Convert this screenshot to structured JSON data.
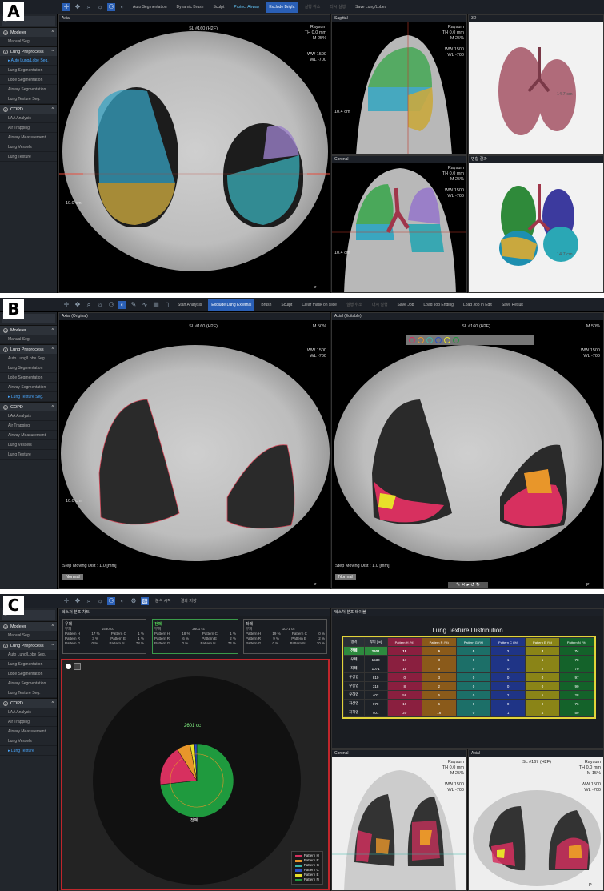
{
  "panel_labels": [
    "A",
    "B",
    "C"
  ],
  "sidebar": {
    "search_placeholder": "Q",
    "groups": [
      {
        "label": "Modeler",
        "items": [
          "Manual Seg."
        ]
      },
      {
        "label": "Lung Preprocess",
        "items": [
          "Auto Lung/Lobe Seg.",
          "Lung Segmentation",
          "Lobe Segmentation",
          "Airway Segmentation",
          "Lung Texture Seg."
        ]
      },
      {
        "label": "COPD",
        "items": [
          "LAA Analysis",
          "Air Trapping",
          "Airway Measurement",
          "Lung Vessels",
          "Lung Texture"
        ]
      }
    ]
  },
  "panelA": {
    "toolbar": {
      "auto_seg": "Auto Segmentation",
      "dynamic_brush": "Dynamic Brush",
      "sculpt": "Sculpt",
      "protect_airway": "Protect Airway",
      "exclude_bright": "Exclude Bright",
      "undo": "실행 취소",
      "redo": "다시 실행",
      "save": "Save Lung/Lobes"
    },
    "axial": {
      "title": "Axial",
      "slice": "SL #160 (H2F)",
      "raysum": "Raysum",
      "th": "TH 0.0 mm",
      "zoom": "M 25%",
      "ww": "WW  1500",
      "wl": "WL   -700",
      "scale": "10.0 cm",
      "orient": "P"
    },
    "sagittal": {
      "title": "Sagittal",
      "raysum": "Raysum",
      "th": "TH 0.0 mm",
      "zoom": "M 25%",
      "ww": "WW  1500",
      "wl": "WL   -700",
      "scale": "10.4 cm"
    },
    "coronal": {
      "title": "Coronal",
      "raysum": "Raysum",
      "th": "TH 0.0 mm",
      "zoom": "M 25%",
      "ww": "WW  1500",
      "wl": "WL   -700",
      "scale": "10.4 cm"
    },
    "view3d": {
      "title": "3D",
      "scale": "14.7 cm"
    },
    "viewMerged": {
      "title": "병합 결과",
      "scale": "14.7 cm"
    }
  },
  "panelB": {
    "toolbar": {
      "start_analysis": "Start Analysis",
      "exclude_lung_external": "Exclude Lung External",
      "brush": "Brush",
      "sculpt": "Sculpt",
      "clear_mask": "Clear mask on slice",
      "undo": "실행 취소",
      "redo": "다시 실행",
      "save_job": "Save Job",
      "load_job_ending": "Load Job Ending",
      "load_job_edit": "Load Job in Edit",
      "save_result": "Save Result"
    },
    "left": {
      "title": "Axial (Original)",
      "slice": "SL #160 (H2F)",
      "zoom": "M 50%",
      "ww": "WW  1500",
      "wl": "WL   -700",
      "scale": "10.0 cm",
      "step": "Step Moving Dist : 1.0 [mm]",
      "normal": "Normal",
      "orient": "P"
    },
    "right": {
      "title": "Axial (Editable)",
      "slice": "SL #160 (H2F)",
      "zoom": "M 50%",
      "ww": "WW  1500",
      "wl": "WL   -700",
      "step": "Step Moving Dist : 1.0 [mm]",
      "normal": "Normal",
      "orient": "P"
    }
  },
  "panelC": {
    "toolbar": {
      "analysis_start": "분석 시작",
      "save_result": "결과 저장"
    },
    "chart_panel_title": "텍스처 분포 차트",
    "table_panel_title": "텍스처 분포 테이블",
    "stat_boxes": [
      {
        "name": "우폐",
        "vol_label": "부피",
        "vol": "1530 cc",
        "rows": [
          [
            "Pattern H",
            "17 %",
            "Pattern C",
            "1 %"
          ],
          [
            "Pattern R",
            "3 %",
            "Pattern E",
            "1 %"
          ],
          [
            "Pattern G",
            "0 %",
            "Pattern N",
            "78 %"
          ]
        ]
      },
      {
        "name": "전폐",
        "vol_label": "부피",
        "vol": "2601 cc",
        "rows": [
          [
            "Pattern H",
            "18 %",
            "Pattern C",
            "1 %"
          ],
          [
            "Pattern R",
            "6 %",
            "Pattern E",
            "2 %"
          ],
          [
            "Pattern G",
            "0 %",
            "Pattern N",
            "74 %"
          ]
        ]
      },
      {
        "name": "좌폐",
        "vol_label": "부피",
        "vol": "1071 cc",
        "rows": [
          [
            "Pattern H",
            "19 %",
            "Pattern C",
            "0 %"
          ],
          [
            "Pattern R",
            "9 %",
            "Pattern E",
            "2 %"
          ],
          [
            "Pattern G",
            "0 %",
            "Pattern N",
            "70 %"
          ]
        ]
      }
    ],
    "pie": {
      "total": "2601 cc",
      "center_label": "전폐"
    },
    "legend": [
      "Pattern H",
      "Pattern R",
      "Pattern G",
      "Pattern C",
      "Pattern E",
      "Pattern N"
    ],
    "legend_colors": [
      "#d7305f",
      "#e8962a",
      "#3bb6a8",
      "#2a4fc8",
      "#e8e02a",
      "#1f9a3e"
    ],
    "table": {
      "title": "Lung Texture Distribution",
      "headers": [
        "영역",
        "부피 [cc]",
        "Pattern H (%)",
        "Pattern R (%)",
        "Pattern G (%)",
        "Pattern C (%)",
        "Pattern E (%)",
        "Pattern N (%)"
      ],
      "rows": [
        [
          "전폐",
          "2601",
          "18",
          "6",
          "0",
          "1",
          "2",
          "74"
        ],
        [
          "우폐",
          "1530",
          "17",
          "3",
          "0",
          "1",
          "1",
          "78"
        ],
        [
          "좌폐",
          "1071",
          "19",
          "9",
          "0",
          "0",
          "2",
          "70"
        ],
        [
          "우상엽",
          "810",
          "0",
          "3",
          "0",
          "0",
          "0",
          "97"
        ],
        [
          "우중엽",
          "318",
          "8",
          "2",
          "0",
          "0",
          "0",
          "90"
        ],
        [
          "우하엽",
          "402",
          "58",
          "6",
          "0",
          "2",
          "5",
          "28"
        ],
        [
          "좌상엽",
          "670",
          "19",
          "6",
          "0",
          "0",
          "0",
          "76"
        ],
        [
          "좌하엽",
          "401",
          "20",
          "16",
          "0",
          "1",
          "4",
          "59"
        ]
      ]
    },
    "coronal": {
      "title": "Coronal",
      "raysum": "Raysum",
      "th": "TH 0.0 mm",
      "zoom": "M 25%",
      "ww": "WW  1500",
      "wl": "WL   -700"
    },
    "axial": {
      "title": "Axial",
      "slice": "SL #167 (H2F)",
      "raysum": "Raysum",
      "th": "TH 0.0 mm",
      "zoom": "M 15%",
      "ww": "WW  1500",
      "wl": "WL   -700",
      "orient": "P"
    }
  },
  "chart_data": {
    "type": "pie",
    "title": "2601 cc",
    "categories": [
      "Pattern H",
      "Pattern R",
      "Pattern G",
      "Pattern C",
      "Pattern E",
      "Pattern N"
    ],
    "values": [
      18,
      6,
      0,
      1,
      2,
      74
    ],
    "colors": [
      "#d7305f",
      "#e8962a",
      "#3bb6a8",
      "#2a4fc8",
      "#e8e02a",
      "#1f9a3e"
    ],
    "legend": "bottom-right"
  }
}
